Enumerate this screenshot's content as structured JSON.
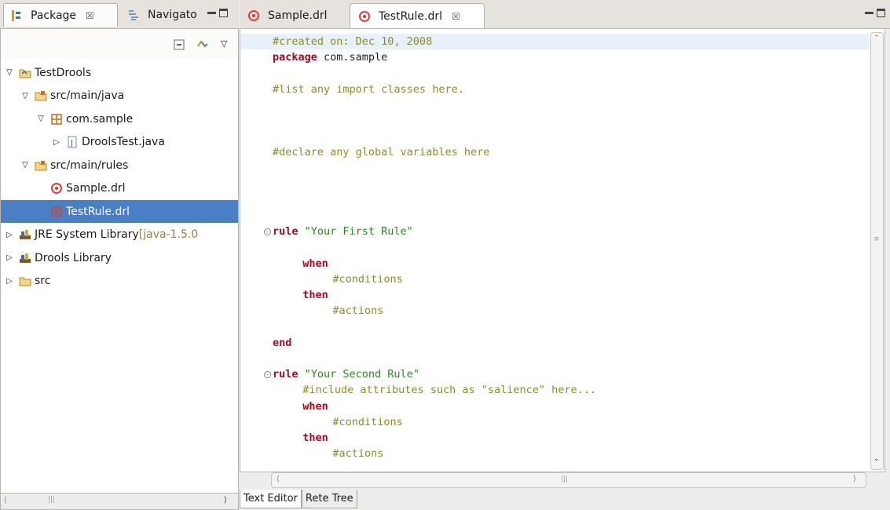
{
  "left_view": {
    "tabs": [
      {
        "label": "Package",
        "close": "☒"
      },
      {
        "label": "Navigato"
      }
    ],
    "tree": [
      {
        "label": "TestDrools",
        "level": 0,
        "twisty": "open",
        "icon": "project-icon"
      },
      {
        "label": "src/main/java",
        "level": 1,
        "twisty": "open",
        "icon": "source-folder-icon"
      },
      {
        "label": "com.sample",
        "level": 2,
        "twisty": "open",
        "icon": "package-icon"
      },
      {
        "label": "DroolsTest.java",
        "level": 3,
        "twisty": "closed",
        "icon": "java-file-icon"
      },
      {
        "label": "src/main/rules",
        "level": 1,
        "twisty": "open",
        "icon": "source-folder-icon"
      },
      {
        "label": "Sample.drl",
        "level": 2,
        "twisty": "none",
        "icon": "drools-file-icon"
      },
      {
        "label": "TestRule.drl",
        "level": 2,
        "twisty": "none",
        "icon": "drools-file-icon",
        "selected": true
      },
      {
        "label": "JRE System Library",
        "suffix": " [java-1.5.0",
        "level": 0,
        "twisty": "closed",
        "icon": "library-icon"
      },
      {
        "label": "Drools Library",
        "level": 0,
        "twisty": "closed",
        "icon": "library-icon"
      },
      {
        "label": "src",
        "level": 0,
        "twisty": "closed",
        "icon": "folder-icon"
      }
    ]
  },
  "editor": {
    "tabs": [
      {
        "label": "Sample.drl"
      },
      {
        "label": "TestRule.drl",
        "close": "☒"
      }
    ],
    "lines": [
      {
        "row": 0,
        "indent": 0,
        "parts": [
          {
            "c": "comment",
            "t": "#created on: Dec 10, 2008"
          }
        ]
      },
      {
        "row": 1,
        "indent": 0,
        "parts": [
          {
            "c": "keyword",
            "t": "package"
          },
          {
            "c": "plain",
            "t": " com.sample"
          }
        ]
      },
      {
        "row": 3,
        "indent": 0,
        "parts": [
          {
            "c": "comment",
            "t": "#list any import classes here."
          }
        ]
      },
      {
        "row": 7,
        "indent": 0,
        "parts": [
          {
            "c": "comment",
            "t": "#declare any global variables here"
          }
        ]
      },
      {
        "row": 12,
        "indent": 0,
        "fold": true,
        "parts": [
          {
            "c": "keyword",
            "t": "rule"
          },
          {
            "c": "string",
            "t": " \"Your First Rule\""
          }
        ]
      },
      {
        "row": 14,
        "indent": 4,
        "parts": [
          {
            "c": "keyword",
            "t": "when"
          }
        ]
      },
      {
        "row": 15,
        "indent": 8,
        "parts": [
          {
            "c": "comment",
            "t": "#conditions"
          }
        ]
      },
      {
        "row": 16,
        "indent": 4,
        "parts": [
          {
            "c": "keyword",
            "t": "then"
          }
        ]
      },
      {
        "row": 17,
        "indent": 8,
        "parts": [
          {
            "c": "comment",
            "t": "#actions"
          }
        ]
      },
      {
        "row": 19,
        "indent": 0,
        "parts": [
          {
            "c": "keyword",
            "t": "end"
          }
        ]
      },
      {
        "row": 21,
        "indent": 0,
        "fold": true,
        "parts": [
          {
            "c": "keyword",
            "t": "rule"
          },
          {
            "c": "string",
            "t": " \"Your Second Rule\""
          }
        ]
      },
      {
        "row": 22,
        "indent": 4,
        "parts": [
          {
            "c": "comment",
            "t": "#include attributes such as \"salience\" here..."
          }
        ]
      },
      {
        "row": 23,
        "indent": 4,
        "parts": [
          {
            "c": "keyword",
            "t": "when"
          }
        ]
      },
      {
        "row": 24,
        "indent": 8,
        "parts": [
          {
            "c": "comment",
            "t": "#conditions"
          }
        ]
      },
      {
        "row": 25,
        "indent": 4,
        "parts": [
          {
            "c": "keyword",
            "t": "then"
          }
        ]
      },
      {
        "row": 26,
        "indent": 8,
        "parts": [
          {
            "c": "comment",
            "t": "#actions"
          }
        ]
      }
    ],
    "bottom_tabs": [
      {
        "label": "Text Editor",
        "active": true
      },
      {
        "label": "Rete Tree"
      }
    ]
  },
  "colors": {
    "selection": "#4a7fc5",
    "keyword": "#9e0b23",
    "comment": "#8f8b27",
    "string": "#2a8a1f"
  }
}
